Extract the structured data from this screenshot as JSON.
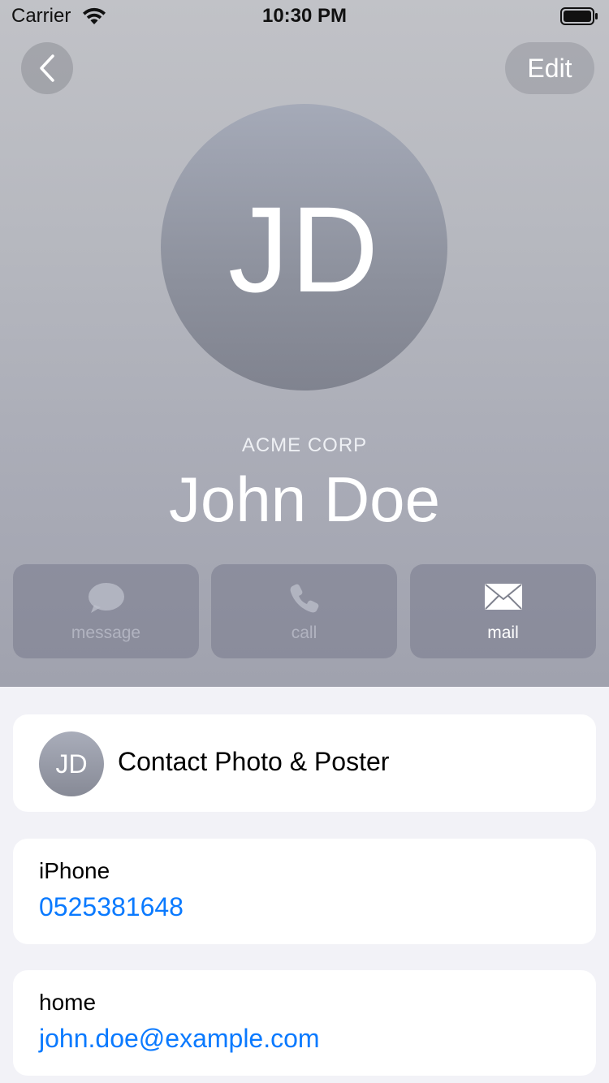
{
  "status_bar": {
    "carrier": "Carrier",
    "time": "10:30 PM"
  },
  "nav": {
    "edit_label": "Edit"
  },
  "contact": {
    "initials": "JD",
    "company": "ACME CORP",
    "name": "John Doe"
  },
  "actions": [
    {
      "label": "message",
      "icon": "message-bubble-icon",
      "enabled": false
    },
    {
      "label": "call",
      "icon": "phone-icon",
      "enabled": false
    },
    {
      "label": "mail",
      "icon": "envelope-icon",
      "enabled": true
    }
  ],
  "photo_card": {
    "initials": "JD",
    "label": "Contact Photo & Poster"
  },
  "phone_card": {
    "label": "iPhone",
    "value": "0525381648"
  },
  "email_card": {
    "label": "home",
    "value": "john.doe@example.com"
  },
  "colors": {
    "link": "#0a7aff",
    "background": "#f2f2f7"
  }
}
